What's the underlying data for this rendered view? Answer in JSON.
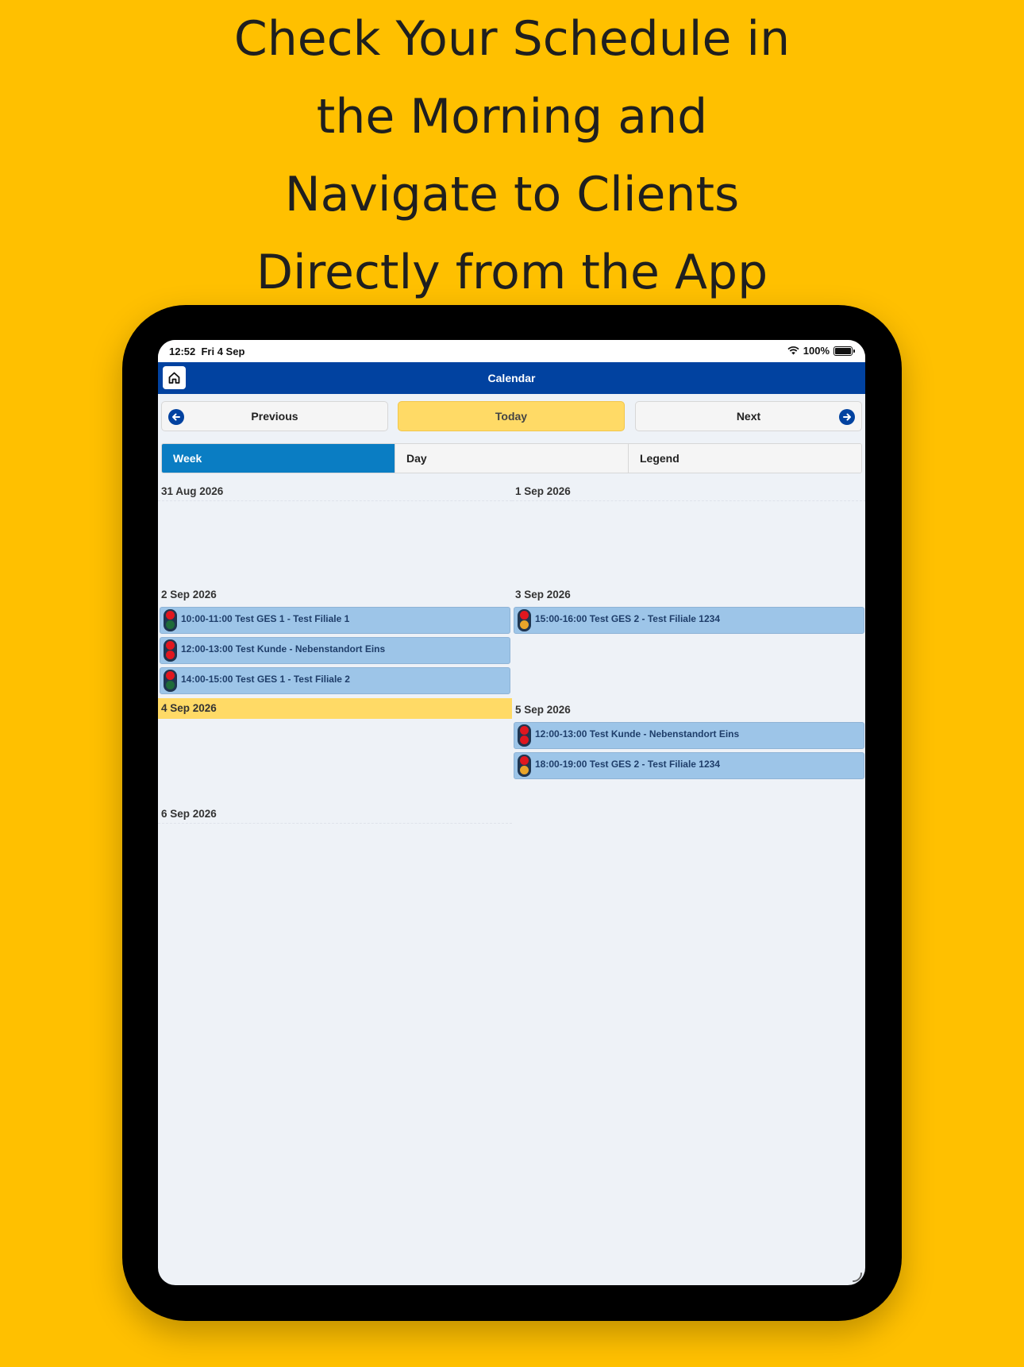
{
  "headline": {
    "line1": "Check Your Schedule in",
    "line2": "the Morning and",
    "line3": "Navigate to Clients",
    "line4": "Directly from the App"
  },
  "status_bar": {
    "time": "12:52",
    "date": "Fri 4 Sep",
    "battery": "100%"
  },
  "nav": {
    "title": "Calendar",
    "home_icon": "home-icon"
  },
  "buttons": {
    "previous": "Previous",
    "today": "Today",
    "next": "Next"
  },
  "tabs": [
    "Week",
    "Day",
    "Legend"
  ],
  "active_tab": "Week",
  "colors": {
    "background": "#FFC000",
    "navbar": "#0142A0",
    "active_tab": "#0A7DC3",
    "today_highlight": "#FFDA66",
    "event": "#9DC5E8",
    "light_red": "#E0171F",
    "light_green": "#1E6B3A",
    "light_amber": "#E9A52A"
  },
  "days": [
    {
      "label": "31 Aug 2026",
      "events": []
    },
    {
      "label": "1 Sep 2026",
      "events": []
    },
    {
      "label": "2 Sep 2026",
      "events": [
        {
          "text": "10:00-11:00 Test GES 1 - Test Filiale 1",
          "light": "green"
        },
        {
          "text": "12:00-13:00 Test Kunde - Nebenstandort Eins",
          "light": "red"
        },
        {
          "text": "14:00-15:00 Test GES 1 - Test Filiale 2",
          "light": "green"
        }
      ]
    },
    {
      "label": "3 Sep 2026",
      "events": [
        {
          "text": "15:00-16:00 Test GES 2 - Test Filiale 1234",
          "light": "amber"
        }
      ]
    },
    {
      "label": "4 Sep 2026",
      "today": true,
      "events": []
    },
    {
      "label": "5 Sep 2026",
      "events": [
        {
          "text": "12:00-13:00 Test Kunde - Nebenstandort Eins",
          "light": "red"
        },
        {
          "text": "18:00-19:00 Test GES 2 - Test Filiale 1234",
          "light": "amber"
        }
      ]
    },
    {
      "label": "6 Sep 2026",
      "events": []
    }
  ]
}
